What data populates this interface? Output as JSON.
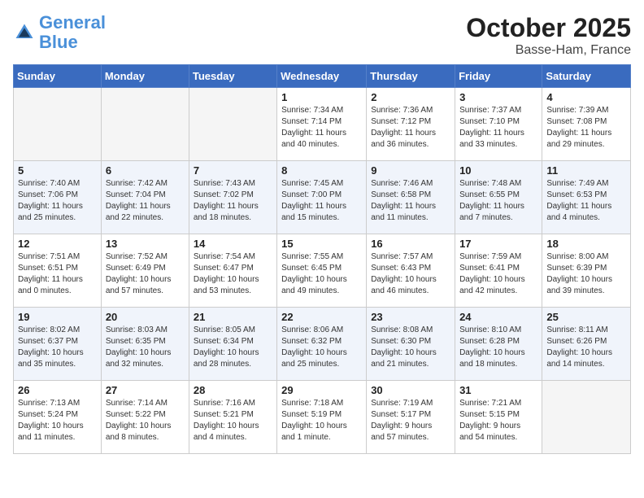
{
  "header": {
    "logo_line1": "General",
    "logo_line2": "Blue",
    "month": "October 2025",
    "location": "Basse-Ham, France"
  },
  "weekdays": [
    "Sunday",
    "Monday",
    "Tuesday",
    "Wednesday",
    "Thursday",
    "Friday",
    "Saturday"
  ],
  "weeks": [
    [
      {
        "day": "",
        "info": ""
      },
      {
        "day": "",
        "info": ""
      },
      {
        "day": "",
        "info": ""
      },
      {
        "day": "1",
        "info": "Sunrise: 7:34 AM\nSunset: 7:14 PM\nDaylight: 11 hours\nand 40 minutes."
      },
      {
        "day": "2",
        "info": "Sunrise: 7:36 AM\nSunset: 7:12 PM\nDaylight: 11 hours\nand 36 minutes."
      },
      {
        "day": "3",
        "info": "Sunrise: 7:37 AM\nSunset: 7:10 PM\nDaylight: 11 hours\nand 33 minutes."
      },
      {
        "day": "4",
        "info": "Sunrise: 7:39 AM\nSunset: 7:08 PM\nDaylight: 11 hours\nand 29 minutes."
      }
    ],
    [
      {
        "day": "5",
        "info": "Sunrise: 7:40 AM\nSunset: 7:06 PM\nDaylight: 11 hours\nand 25 minutes."
      },
      {
        "day": "6",
        "info": "Sunrise: 7:42 AM\nSunset: 7:04 PM\nDaylight: 11 hours\nand 22 minutes."
      },
      {
        "day": "7",
        "info": "Sunrise: 7:43 AM\nSunset: 7:02 PM\nDaylight: 11 hours\nand 18 minutes."
      },
      {
        "day": "8",
        "info": "Sunrise: 7:45 AM\nSunset: 7:00 PM\nDaylight: 11 hours\nand 15 minutes."
      },
      {
        "day": "9",
        "info": "Sunrise: 7:46 AM\nSunset: 6:58 PM\nDaylight: 11 hours\nand 11 minutes."
      },
      {
        "day": "10",
        "info": "Sunrise: 7:48 AM\nSunset: 6:55 PM\nDaylight: 11 hours\nand 7 minutes."
      },
      {
        "day": "11",
        "info": "Sunrise: 7:49 AM\nSunset: 6:53 PM\nDaylight: 11 hours\nand 4 minutes."
      }
    ],
    [
      {
        "day": "12",
        "info": "Sunrise: 7:51 AM\nSunset: 6:51 PM\nDaylight: 11 hours\nand 0 minutes."
      },
      {
        "day": "13",
        "info": "Sunrise: 7:52 AM\nSunset: 6:49 PM\nDaylight: 10 hours\nand 57 minutes."
      },
      {
        "day": "14",
        "info": "Sunrise: 7:54 AM\nSunset: 6:47 PM\nDaylight: 10 hours\nand 53 minutes."
      },
      {
        "day": "15",
        "info": "Sunrise: 7:55 AM\nSunset: 6:45 PM\nDaylight: 10 hours\nand 49 minutes."
      },
      {
        "day": "16",
        "info": "Sunrise: 7:57 AM\nSunset: 6:43 PM\nDaylight: 10 hours\nand 46 minutes."
      },
      {
        "day": "17",
        "info": "Sunrise: 7:59 AM\nSunset: 6:41 PM\nDaylight: 10 hours\nand 42 minutes."
      },
      {
        "day": "18",
        "info": "Sunrise: 8:00 AM\nSunset: 6:39 PM\nDaylight: 10 hours\nand 39 minutes."
      }
    ],
    [
      {
        "day": "19",
        "info": "Sunrise: 8:02 AM\nSunset: 6:37 PM\nDaylight: 10 hours\nand 35 minutes."
      },
      {
        "day": "20",
        "info": "Sunrise: 8:03 AM\nSunset: 6:35 PM\nDaylight: 10 hours\nand 32 minutes."
      },
      {
        "day": "21",
        "info": "Sunrise: 8:05 AM\nSunset: 6:34 PM\nDaylight: 10 hours\nand 28 minutes."
      },
      {
        "day": "22",
        "info": "Sunrise: 8:06 AM\nSunset: 6:32 PM\nDaylight: 10 hours\nand 25 minutes."
      },
      {
        "day": "23",
        "info": "Sunrise: 8:08 AM\nSunset: 6:30 PM\nDaylight: 10 hours\nand 21 minutes."
      },
      {
        "day": "24",
        "info": "Sunrise: 8:10 AM\nSunset: 6:28 PM\nDaylight: 10 hours\nand 18 minutes."
      },
      {
        "day": "25",
        "info": "Sunrise: 8:11 AM\nSunset: 6:26 PM\nDaylight: 10 hours\nand 14 minutes."
      }
    ],
    [
      {
        "day": "26",
        "info": "Sunrise: 7:13 AM\nSunset: 5:24 PM\nDaylight: 10 hours\nand 11 minutes."
      },
      {
        "day": "27",
        "info": "Sunrise: 7:14 AM\nSunset: 5:22 PM\nDaylight: 10 hours\nand 8 minutes."
      },
      {
        "day": "28",
        "info": "Sunrise: 7:16 AM\nSunset: 5:21 PM\nDaylight: 10 hours\nand 4 minutes."
      },
      {
        "day": "29",
        "info": "Sunrise: 7:18 AM\nSunset: 5:19 PM\nDaylight: 10 hours\nand 1 minute."
      },
      {
        "day": "30",
        "info": "Sunrise: 7:19 AM\nSunset: 5:17 PM\nDaylight: 9 hours\nand 57 minutes."
      },
      {
        "day": "31",
        "info": "Sunrise: 7:21 AM\nSunset: 5:15 PM\nDaylight: 9 hours\nand 54 minutes."
      },
      {
        "day": "",
        "info": ""
      }
    ]
  ]
}
